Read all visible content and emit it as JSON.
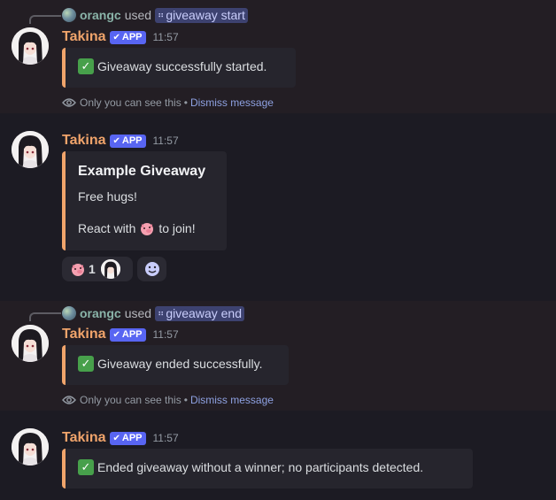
{
  "messages": [
    {
      "command": {
        "user": "orangc",
        "used": "used",
        "name": "giveaway start"
      },
      "author": "Takina",
      "badge": "APP",
      "time": "11:57",
      "text": "Giveaway successfully started.",
      "ephemeral": {
        "note": "Only you can see this",
        "sep": "•",
        "dismiss": "Dismiss message"
      }
    },
    {
      "author": "Takina",
      "badge": "APP",
      "time": "11:57",
      "embed": {
        "title": "Example Giveaway",
        "body": "Free hugs!",
        "react_prefix": "React with",
        "react_suffix": "to join!"
      },
      "reaction": {
        "count": "1",
        "emoji": "pig-emoji"
      }
    },
    {
      "command": {
        "user": "orangc",
        "used": "used",
        "name": "giveaway end"
      },
      "author": "Takina",
      "badge": "APP",
      "time": "11:57",
      "text": "Giveaway ended successfully.",
      "ephemeral": {
        "note": "Only you can see this",
        "sep": "•",
        "dismiss": "Dismiss message"
      }
    },
    {
      "author": "Takina",
      "badge": "APP",
      "time": "11:57",
      "text": "Ended giveaway without a winner; no participants detected."
    }
  ],
  "colors": {
    "accent": "#f0a46b",
    "badge": "#5865f2",
    "link": "#8ea1e1",
    "success": "#47a04b"
  }
}
